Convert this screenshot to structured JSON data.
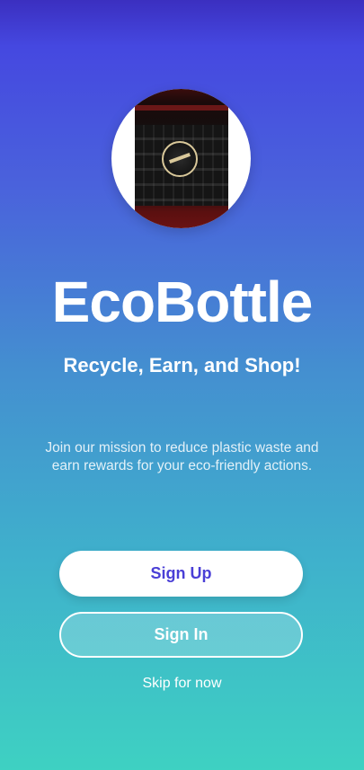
{
  "app": {
    "title": "EcoBottle",
    "tagline": "Recycle, Earn, and Shop!",
    "mission": "Join our mission to reduce plastic waste and earn rewards for your eco-friendly actions."
  },
  "actions": {
    "sign_up_label": "Sign Up",
    "sign_in_label": "Sign In",
    "skip_label": "Skip for now"
  },
  "logo": {
    "icon": "app-logo-image"
  },
  "colors": {
    "gradient_top": "#3b2fc0",
    "gradient_bottom": "#3ed1c2",
    "sign_up_text": "#4a3fd6"
  }
}
